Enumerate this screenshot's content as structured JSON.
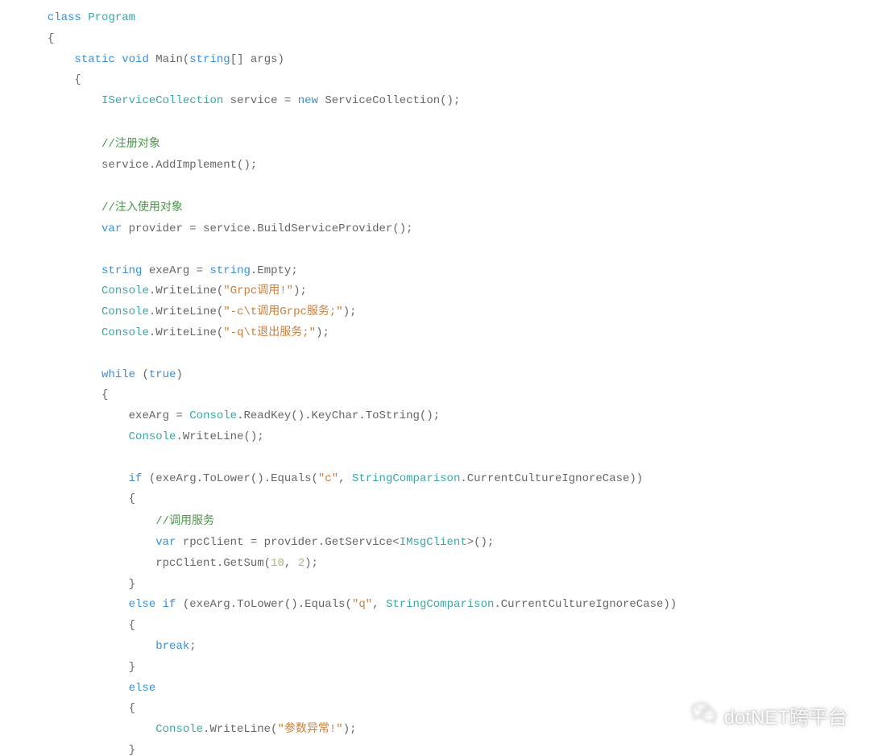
{
  "code": {
    "language": "csharp",
    "lines": [
      {
        "indent": 1,
        "tokens": [
          {
            "t": "kw",
            "v": "class"
          },
          {
            "t": "sp"
          },
          {
            "t": "type",
            "v": "Program"
          }
        ]
      },
      {
        "indent": 1,
        "tokens": [
          {
            "t": "id",
            "v": "{"
          }
        ]
      },
      {
        "indent": 2,
        "tokens": [
          {
            "t": "kw",
            "v": "static"
          },
          {
            "t": "sp"
          },
          {
            "t": "kw",
            "v": "void"
          },
          {
            "t": "sp"
          },
          {
            "t": "id",
            "v": "Main("
          },
          {
            "t": "kw",
            "v": "string"
          },
          {
            "t": "id",
            "v": "[] args)"
          }
        ]
      },
      {
        "indent": 2,
        "tokens": [
          {
            "t": "id",
            "v": "{"
          }
        ]
      },
      {
        "indent": 3,
        "tokens": [
          {
            "t": "type",
            "v": "IServiceCollection"
          },
          {
            "t": "sp"
          },
          {
            "t": "id",
            "v": "service = "
          },
          {
            "t": "kw",
            "v": "new"
          },
          {
            "t": "sp"
          },
          {
            "t": "id",
            "v": "ServiceCollection();"
          }
        ]
      },
      {
        "indent": 0,
        "tokens": []
      },
      {
        "indent": 3,
        "tokens": [
          {
            "t": "cm-slash",
            "v": "//"
          },
          {
            "t": "cm",
            "v": "注册对象"
          }
        ]
      },
      {
        "indent": 3,
        "tokens": [
          {
            "t": "id",
            "v": "service.AddImplement();"
          }
        ]
      },
      {
        "indent": 0,
        "tokens": []
      },
      {
        "indent": 3,
        "tokens": [
          {
            "t": "cm-slash",
            "v": "//"
          },
          {
            "t": "cm",
            "v": "注入使用对象"
          }
        ]
      },
      {
        "indent": 3,
        "tokens": [
          {
            "t": "kw",
            "v": "var"
          },
          {
            "t": "sp"
          },
          {
            "t": "id",
            "v": "provider = service.BuildServiceProvider();"
          }
        ]
      },
      {
        "indent": 0,
        "tokens": []
      },
      {
        "indent": 3,
        "tokens": [
          {
            "t": "kw",
            "v": "string"
          },
          {
            "t": "sp"
          },
          {
            "t": "id",
            "v": "exeArg = "
          },
          {
            "t": "kw",
            "v": "string"
          },
          {
            "t": "id",
            "v": ".Empty;"
          }
        ]
      },
      {
        "indent": 3,
        "tokens": [
          {
            "t": "type",
            "v": "Console"
          },
          {
            "t": "id",
            "v": ".WriteLine("
          },
          {
            "t": "str",
            "v": "\"Grpc调用!\""
          },
          {
            "t": "id",
            "v": ");"
          }
        ]
      },
      {
        "indent": 3,
        "tokens": [
          {
            "t": "type",
            "v": "Console"
          },
          {
            "t": "id",
            "v": ".WriteLine("
          },
          {
            "t": "str",
            "v": "\"-c\\t调用Grpc服务;\""
          },
          {
            "t": "id",
            "v": ");"
          }
        ]
      },
      {
        "indent": 3,
        "tokens": [
          {
            "t": "type",
            "v": "Console"
          },
          {
            "t": "id",
            "v": ".WriteLine("
          },
          {
            "t": "str",
            "v": "\"-q\\t退出服务;\""
          },
          {
            "t": "id",
            "v": ");"
          }
        ]
      },
      {
        "indent": 0,
        "tokens": []
      },
      {
        "indent": 3,
        "tokens": [
          {
            "t": "kw",
            "v": "while"
          },
          {
            "t": "sp"
          },
          {
            "t": "id",
            "v": "("
          },
          {
            "t": "kw",
            "v": "true"
          },
          {
            "t": "id",
            "v": ")"
          }
        ]
      },
      {
        "indent": 3,
        "tokens": [
          {
            "t": "id",
            "v": "{"
          }
        ]
      },
      {
        "indent": 4,
        "tokens": [
          {
            "t": "id",
            "v": "exeArg = "
          },
          {
            "t": "type",
            "v": "Console"
          },
          {
            "t": "id",
            "v": ".ReadKey().KeyChar.ToString();"
          }
        ]
      },
      {
        "indent": 4,
        "tokens": [
          {
            "t": "type",
            "v": "Console"
          },
          {
            "t": "id",
            "v": ".WriteLine();"
          }
        ]
      },
      {
        "indent": 0,
        "tokens": []
      },
      {
        "indent": 4,
        "tokens": [
          {
            "t": "kw",
            "v": "if"
          },
          {
            "t": "sp"
          },
          {
            "t": "id",
            "v": "(exeArg.ToLower().Equals("
          },
          {
            "t": "str",
            "v": "\"c\""
          },
          {
            "t": "id",
            "v": ", "
          },
          {
            "t": "type",
            "v": "StringComparison"
          },
          {
            "t": "id",
            "v": ".CurrentCultureIgnoreCase))"
          }
        ]
      },
      {
        "indent": 4,
        "tokens": [
          {
            "t": "id",
            "v": "{"
          }
        ]
      },
      {
        "indent": 5,
        "tokens": [
          {
            "t": "cm-slash",
            "v": "//"
          },
          {
            "t": "cm",
            "v": "调用服务"
          }
        ]
      },
      {
        "indent": 5,
        "tokens": [
          {
            "t": "kw",
            "v": "var"
          },
          {
            "t": "sp"
          },
          {
            "t": "id",
            "v": "rpcClient = provider.GetService<"
          },
          {
            "t": "type",
            "v": "IMsgClient"
          },
          {
            "t": "id",
            "v": ">();"
          }
        ]
      },
      {
        "indent": 5,
        "tokens": [
          {
            "t": "id",
            "v": "rpcClient.GetSum("
          },
          {
            "t": "num",
            "v": "10"
          },
          {
            "t": "id",
            "v": ", "
          },
          {
            "t": "num",
            "v": "2"
          },
          {
            "t": "id",
            "v": ");"
          }
        ]
      },
      {
        "indent": 4,
        "tokens": [
          {
            "t": "id",
            "v": "}"
          }
        ]
      },
      {
        "indent": 4,
        "tokens": [
          {
            "t": "kw",
            "v": "else"
          },
          {
            "t": "sp"
          },
          {
            "t": "kw",
            "v": "if"
          },
          {
            "t": "sp"
          },
          {
            "t": "id",
            "v": "(exeArg.ToLower().Equals("
          },
          {
            "t": "str",
            "v": "\"q\""
          },
          {
            "t": "id",
            "v": ", "
          },
          {
            "t": "type",
            "v": "StringComparison"
          },
          {
            "t": "id",
            "v": ".CurrentCultureIgnoreCase))"
          }
        ]
      },
      {
        "indent": 4,
        "tokens": [
          {
            "t": "id",
            "v": "{"
          }
        ]
      },
      {
        "indent": 5,
        "tokens": [
          {
            "t": "kw",
            "v": "break"
          },
          {
            "t": "id",
            "v": ";"
          }
        ]
      },
      {
        "indent": 4,
        "tokens": [
          {
            "t": "id",
            "v": "}"
          }
        ]
      },
      {
        "indent": 4,
        "tokens": [
          {
            "t": "kw",
            "v": "else"
          }
        ]
      },
      {
        "indent": 4,
        "tokens": [
          {
            "t": "id",
            "v": "{"
          }
        ]
      },
      {
        "indent": 5,
        "tokens": [
          {
            "t": "type",
            "v": "Console"
          },
          {
            "t": "id",
            "v": ".WriteLine("
          },
          {
            "t": "str",
            "v": "\"参数异常!\""
          },
          {
            "t": "id",
            "v": ");"
          }
        ]
      },
      {
        "indent": 4,
        "tokens": [
          {
            "t": "id",
            "v": "}"
          }
        ]
      }
    ]
  },
  "watermark": {
    "text": "dotNET跨平台"
  }
}
